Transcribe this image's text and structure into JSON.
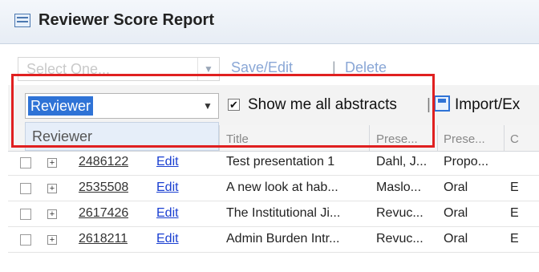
{
  "window": {
    "title": "Reviewer Score Report"
  },
  "toolbar1": {
    "select_placeholder": "Select One...",
    "save_edit_label": "Save/Edit",
    "separator": "|",
    "delete_label": "Delete"
  },
  "toolbar2": {
    "view_select_value": "Reviewer",
    "show_all_label": "Show me all abstracts",
    "show_all_checked": true,
    "separator": "|",
    "import_export_label": "Import/Ex"
  },
  "dropdown": {
    "items": [
      "Reviewer"
    ]
  },
  "table": {
    "headers": [
      "Title",
      "Prese...",
      "Prese...",
      "C"
    ],
    "rows": [
      {
        "id": "2486122",
        "edit": "Edit",
        "title": "Test presentation 1",
        "presenter": "Dahl, J...",
        "type": "Propo...",
        "extra": ""
      },
      {
        "id": "2535508",
        "edit": "Edit",
        "title": "A new look at hab...",
        "presenter": "Maslo...",
        "type": "Oral",
        "extra": "E"
      },
      {
        "id": "2617426",
        "edit": "Edit",
        "title": "The Institutional Ji...",
        "presenter": "Revuc...",
        "type": "Oral",
        "extra": "E"
      },
      {
        "id": "2618211",
        "edit": "Edit",
        "title": "Admin Burden Intr...",
        "presenter": "Revuc...",
        "type": "Oral",
        "extra": "E"
      }
    ]
  },
  "colors": {
    "highlight": "#e02020",
    "selection": "#2f73d6",
    "link": "#1a3fd1"
  }
}
